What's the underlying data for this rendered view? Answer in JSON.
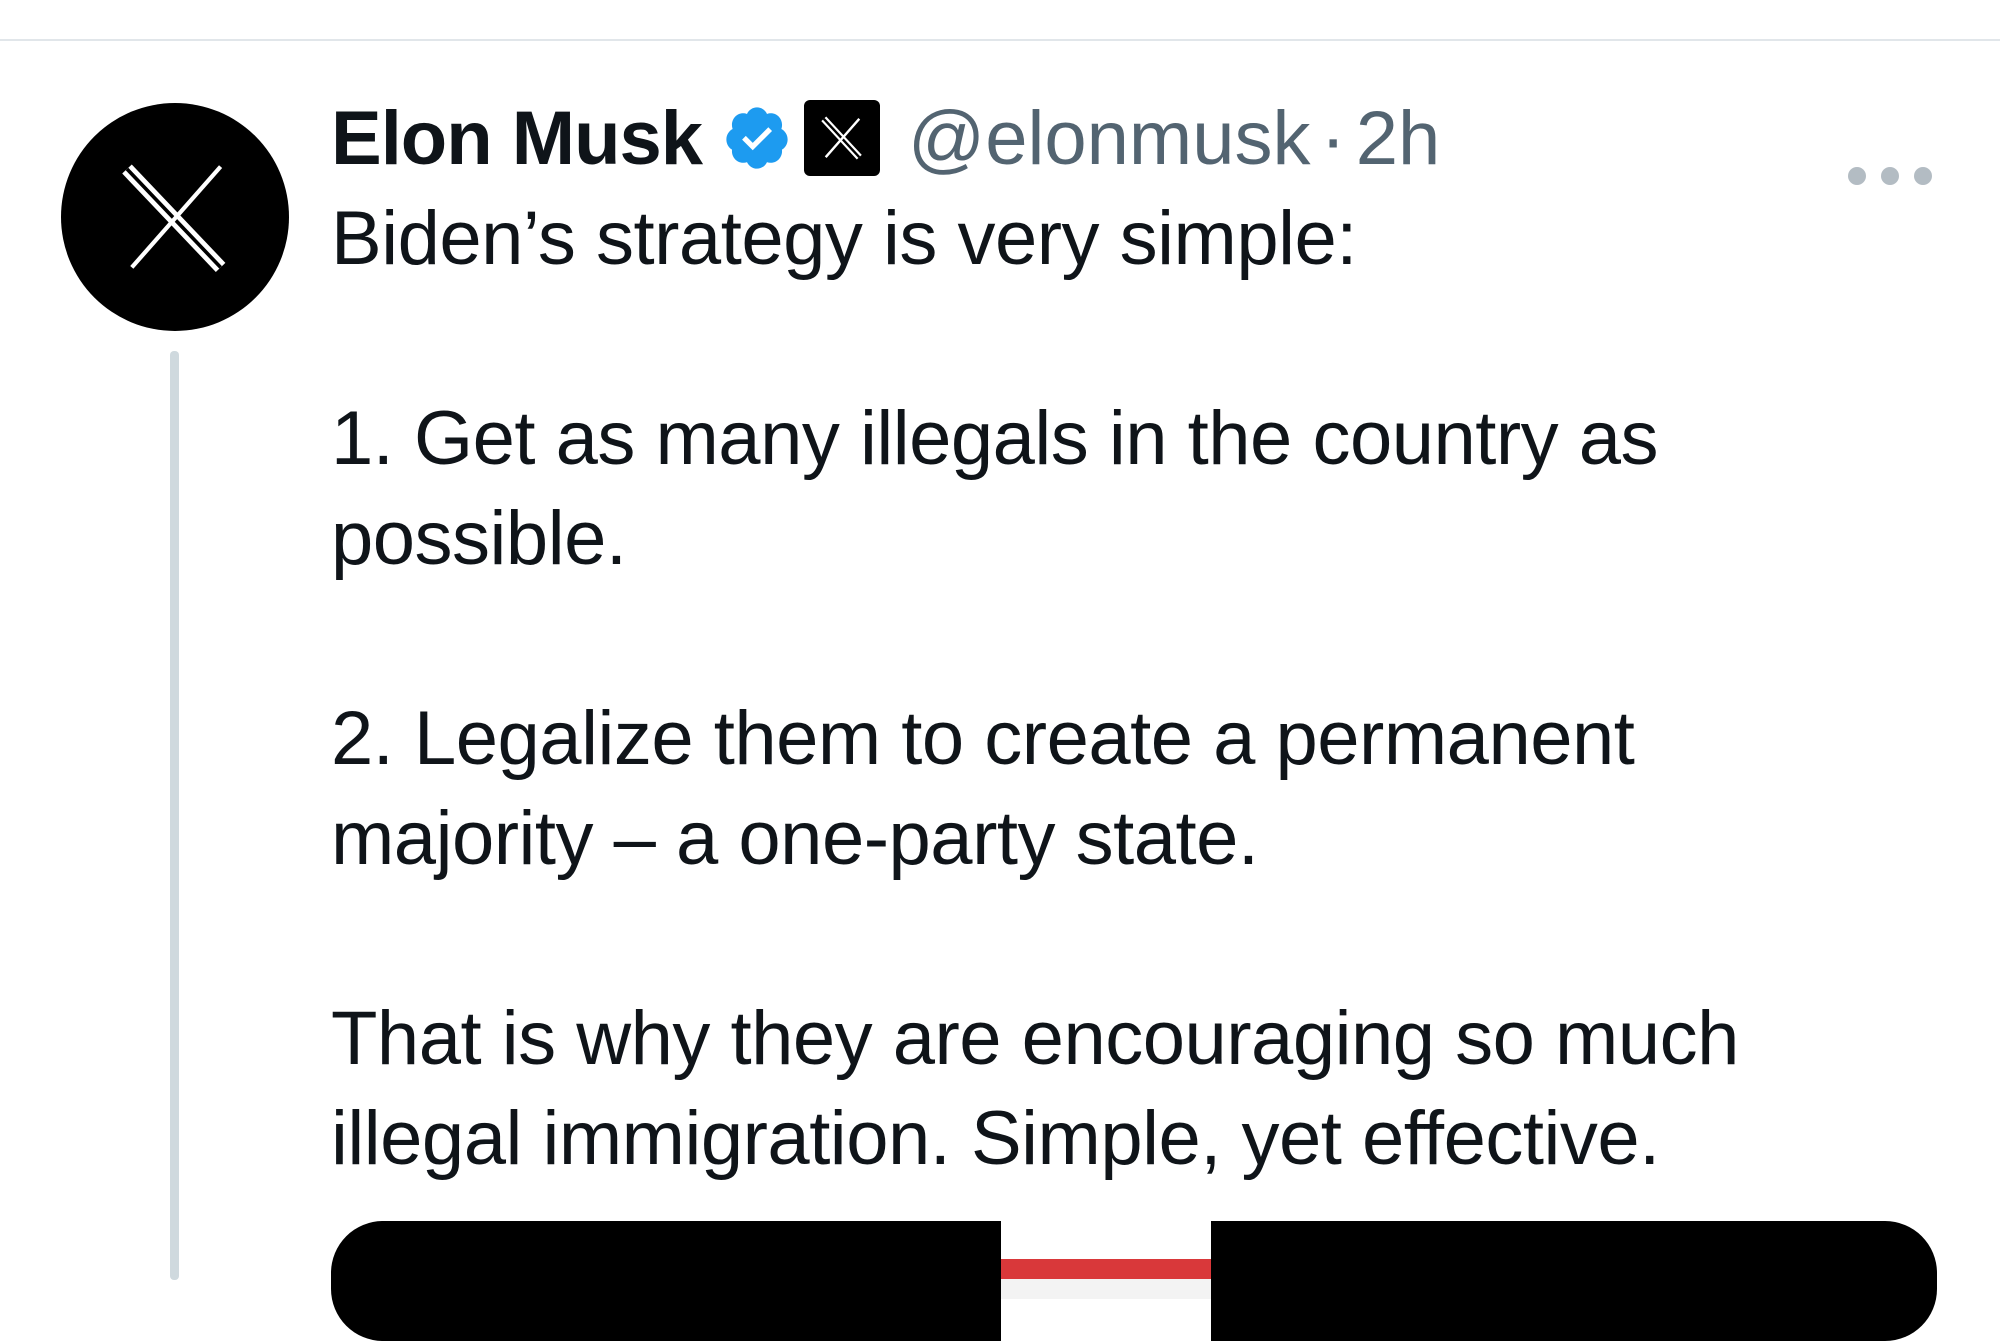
{
  "tweet": {
    "author": {
      "name": "Elon Musk",
      "handle": "@elonmusk",
      "avatar_icon": "x-logo-icon",
      "verified_icon": "verified-badge-icon",
      "verified_color": "#1d9bf0",
      "affiliate_icon": "x-affiliate-badge-icon"
    },
    "separator": "·",
    "timestamp": "2h",
    "more_icon": "more-options-icon",
    "text": {
      "line1": "Biden’s strategy is very simple:",
      "point1": "1. Get as many illegals in the country as\npossible.",
      "point2": "2. Legalize them to create a permanent\nmajority – a one-party state.",
      "closing": "That is why they are encouraging so much\nillegal immigration. Simple, yet effective."
    },
    "media": {
      "type": "image-preview"
    }
  },
  "colors": {
    "text_primary": "#0f1419",
    "text_secondary": "#536471",
    "thread_line": "#cfd9de",
    "divider": "#e1e6ea"
  }
}
